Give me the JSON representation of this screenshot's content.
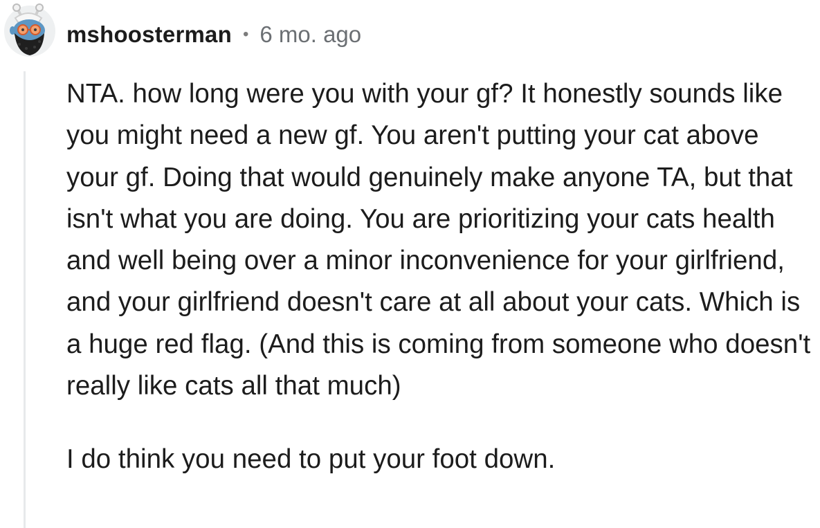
{
  "comment": {
    "avatar_icon": "snoo-avatar-icon",
    "username": "mshoosterman",
    "separator": "•",
    "timestamp": "6 mo. ago",
    "paragraphs": [
      "NTA. how long were you with your gf? It honestly sounds like you might need a new gf. You aren't putting your cat above your gf. Doing that would genuinely make anyone TA, but that isn't what you are doing. You are prioritizing your cats health and well being over a minor inconvenience for your girlfriend, and your girlfriend doesn't care at all about your cats. Which is a huge red flag. (And this is coming from someone who doesn't really like cats all that much)",
      "I do think you need to put your foot down."
    ]
  }
}
